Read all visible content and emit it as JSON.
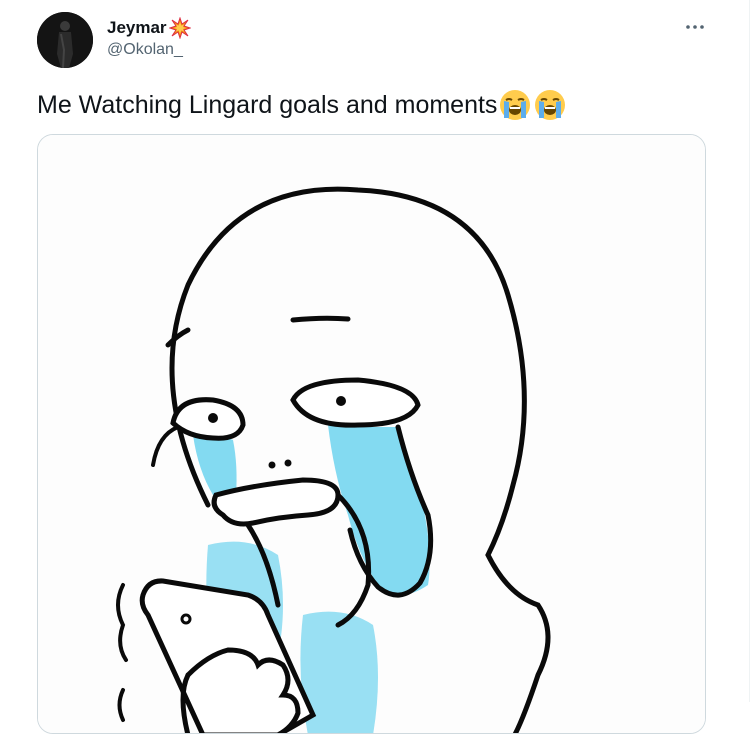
{
  "tweet": {
    "author": {
      "display_name": "Jeymar",
      "handle": "@Okolan_",
      "name_emoji": "collision-icon"
    },
    "more_icon": "more-options-icon",
    "text": "Me Watching Lingard goals and moments",
    "text_emojis": [
      "loudly-crying-face-icon",
      "loudly-crying-face-icon"
    ],
    "media": {
      "description_icon": "crying-meme-drawing"
    }
  },
  "colors": {
    "text_primary": "#0f1419",
    "text_secondary": "#536471",
    "border": "#cfd9de",
    "tears": "#5fd0ec"
  }
}
